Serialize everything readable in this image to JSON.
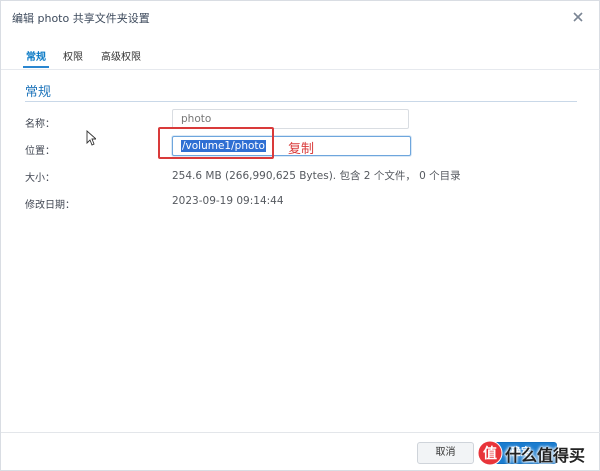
{
  "window": {
    "title": "编辑 photo 共享文件夹设置",
    "close_icon": "close-icon"
  },
  "tabs": [
    {
      "label": "常规",
      "active": true
    },
    {
      "label": "权限",
      "active": false
    },
    {
      "label": "高级权限",
      "active": false
    }
  ],
  "section": {
    "title": "常规"
  },
  "form": {
    "name_label": "名称：",
    "name_value": "photo",
    "location_label": "位置：",
    "location_value": "/volume1/photo",
    "size_label": "大小：",
    "size_value": "254.6 MB (266,990,625 Bytes). 包含 2 个文件， 0 个目录",
    "modified_label": "修改日期：",
    "modified_value": "2023-09-19 09:14:44"
  },
  "annotation": {
    "text": "复制",
    "color": "#d93a3a"
  },
  "buttons": {
    "cancel_label": "取消",
    "ok_label": "确定"
  },
  "watermark": {
    "text": "什么值得买",
    "icon": "zhi-logo-icon"
  },
  "colors": {
    "accent": "#1f75bb",
    "primary_button": "#1b7ccf",
    "selection": "#2f6fd3"
  }
}
